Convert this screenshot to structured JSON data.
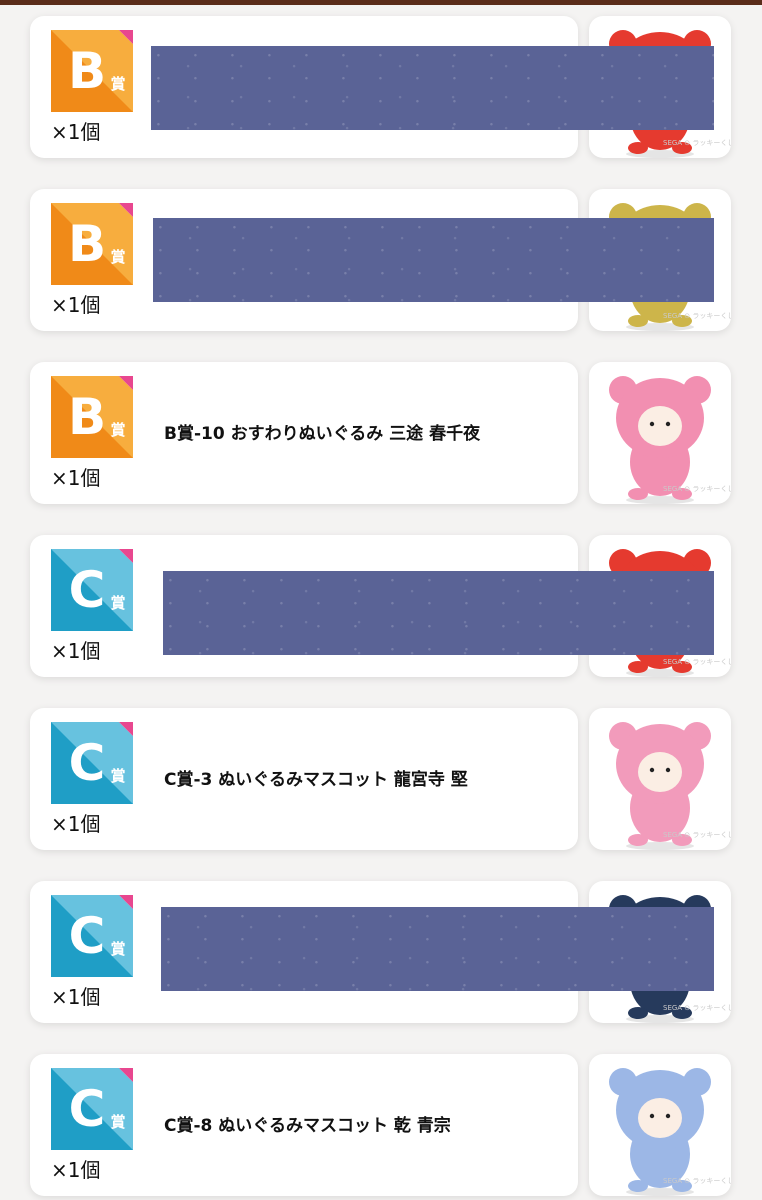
{
  "palette": {
    "top_bar": "#5a2c1a",
    "badge_b_light": "#f7ad3e",
    "badge_b_dark": "#f08a18",
    "badge_c_light": "#67c2df",
    "badge_c_dark": "#1f9ec6",
    "badge_corner": "#e8478f",
    "redaction": "#5a6396"
  },
  "prizes": [
    {
      "badge": {
        "letter": "B",
        "kanji": "賞"
      },
      "quantity": "×1個",
      "name": "",
      "redacted": true,
      "image": {
        "icon": "plush-red-bear",
        "color": "#e53a2f"
      }
    },
    {
      "badge": {
        "letter": "B",
        "kanji": "賞"
      },
      "quantity": "×1個",
      "name": "",
      "redacted": true,
      "image": {
        "icon": "plush-yellow-bear",
        "color": "#cdb54a"
      }
    },
    {
      "badge": {
        "letter": "B",
        "kanji": "賞"
      },
      "quantity": "×1個",
      "name": "B賞-10 おすわりぬいぐるみ 三途 春千夜",
      "redacted": false,
      "image": {
        "icon": "plush-pink-bear",
        "color": "#f28fb1"
      }
    },
    {
      "badge": {
        "letter": "C",
        "kanji": "賞"
      },
      "quantity": "×1個",
      "name": "",
      "redacted": true,
      "image": {
        "icon": "plush-red-bear",
        "color": "#e53a2f"
      }
    },
    {
      "badge": {
        "letter": "C",
        "kanji": "賞"
      },
      "quantity": "×1個",
      "name": "C賞-3 ぬいぐるみマスコット 龍宮寺 堅",
      "redacted": false,
      "image": {
        "icon": "plush-pink-bear",
        "color": "#f29bbb"
      }
    },
    {
      "badge": {
        "letter": "C",
        "kanji": "賞"
      },
      "quantity": "×1個",
      "name": "",
      "redacted": true,
      "image": {
        "icon": "plush-navy-bear",
        "color": "#263a5c"
      }
    },
    {
      "badge": {
        "letter": "C",
        "kanji": "賞"
      },
      "quantity": "×1個",
      "name": "C賞-8 ぬいぐるみマスコット 乾 青宗",
      "redacted": false,
      "image": {
        "icon": "plush-blue-bear",
        "color": "#9cb7e6"
      }
    }
  ]
}
